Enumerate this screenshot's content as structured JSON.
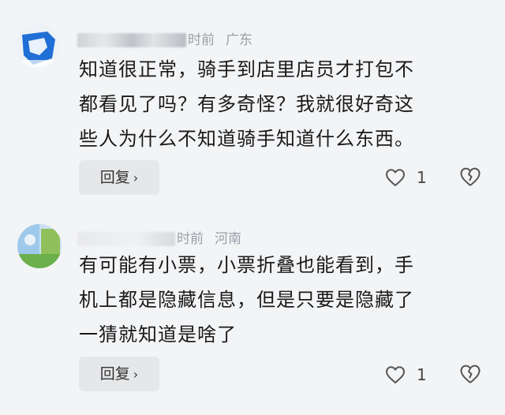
{
  "comments": [
    {
      "time": "时前",
      "location": "广东",
      "lines": [
        "知道很正常，骑手到店里店员才打包不",
        "都看见了吗？有多奇怪？我就很好奇这",
        "些人为什么不知道骑手知道什么东西。"
      ],
      "reply_label": "回复",
      "reply_chevron": "›",
      "like_count": "1"
    },
    {
      "time": "时前",
      "location": "河南",
      "lines": [
        "有可能有小票，小票折叠也能看到，手",
        "机上都是隐藏信息，但是只要是隐藏了",
        "一猜就知道是啥了"
      ],
      "reply_label": "回复",
      "reply_chevron": "›",
      "like_count": "1"
    }
  ],
  "colors": {
    "background": "#f3f4f6",
    "avatar1_blue": "#1f6fd6",
    "avatar2_green": "#6bb04a",
    "meta_gray": "#9aa0a8"
  },
  "icons": {
    "like": "heart-outline-icon",
    "dislike": "broken-heart-icon",
    "reply_arrow": "chevron-right-icon"
  }
}
